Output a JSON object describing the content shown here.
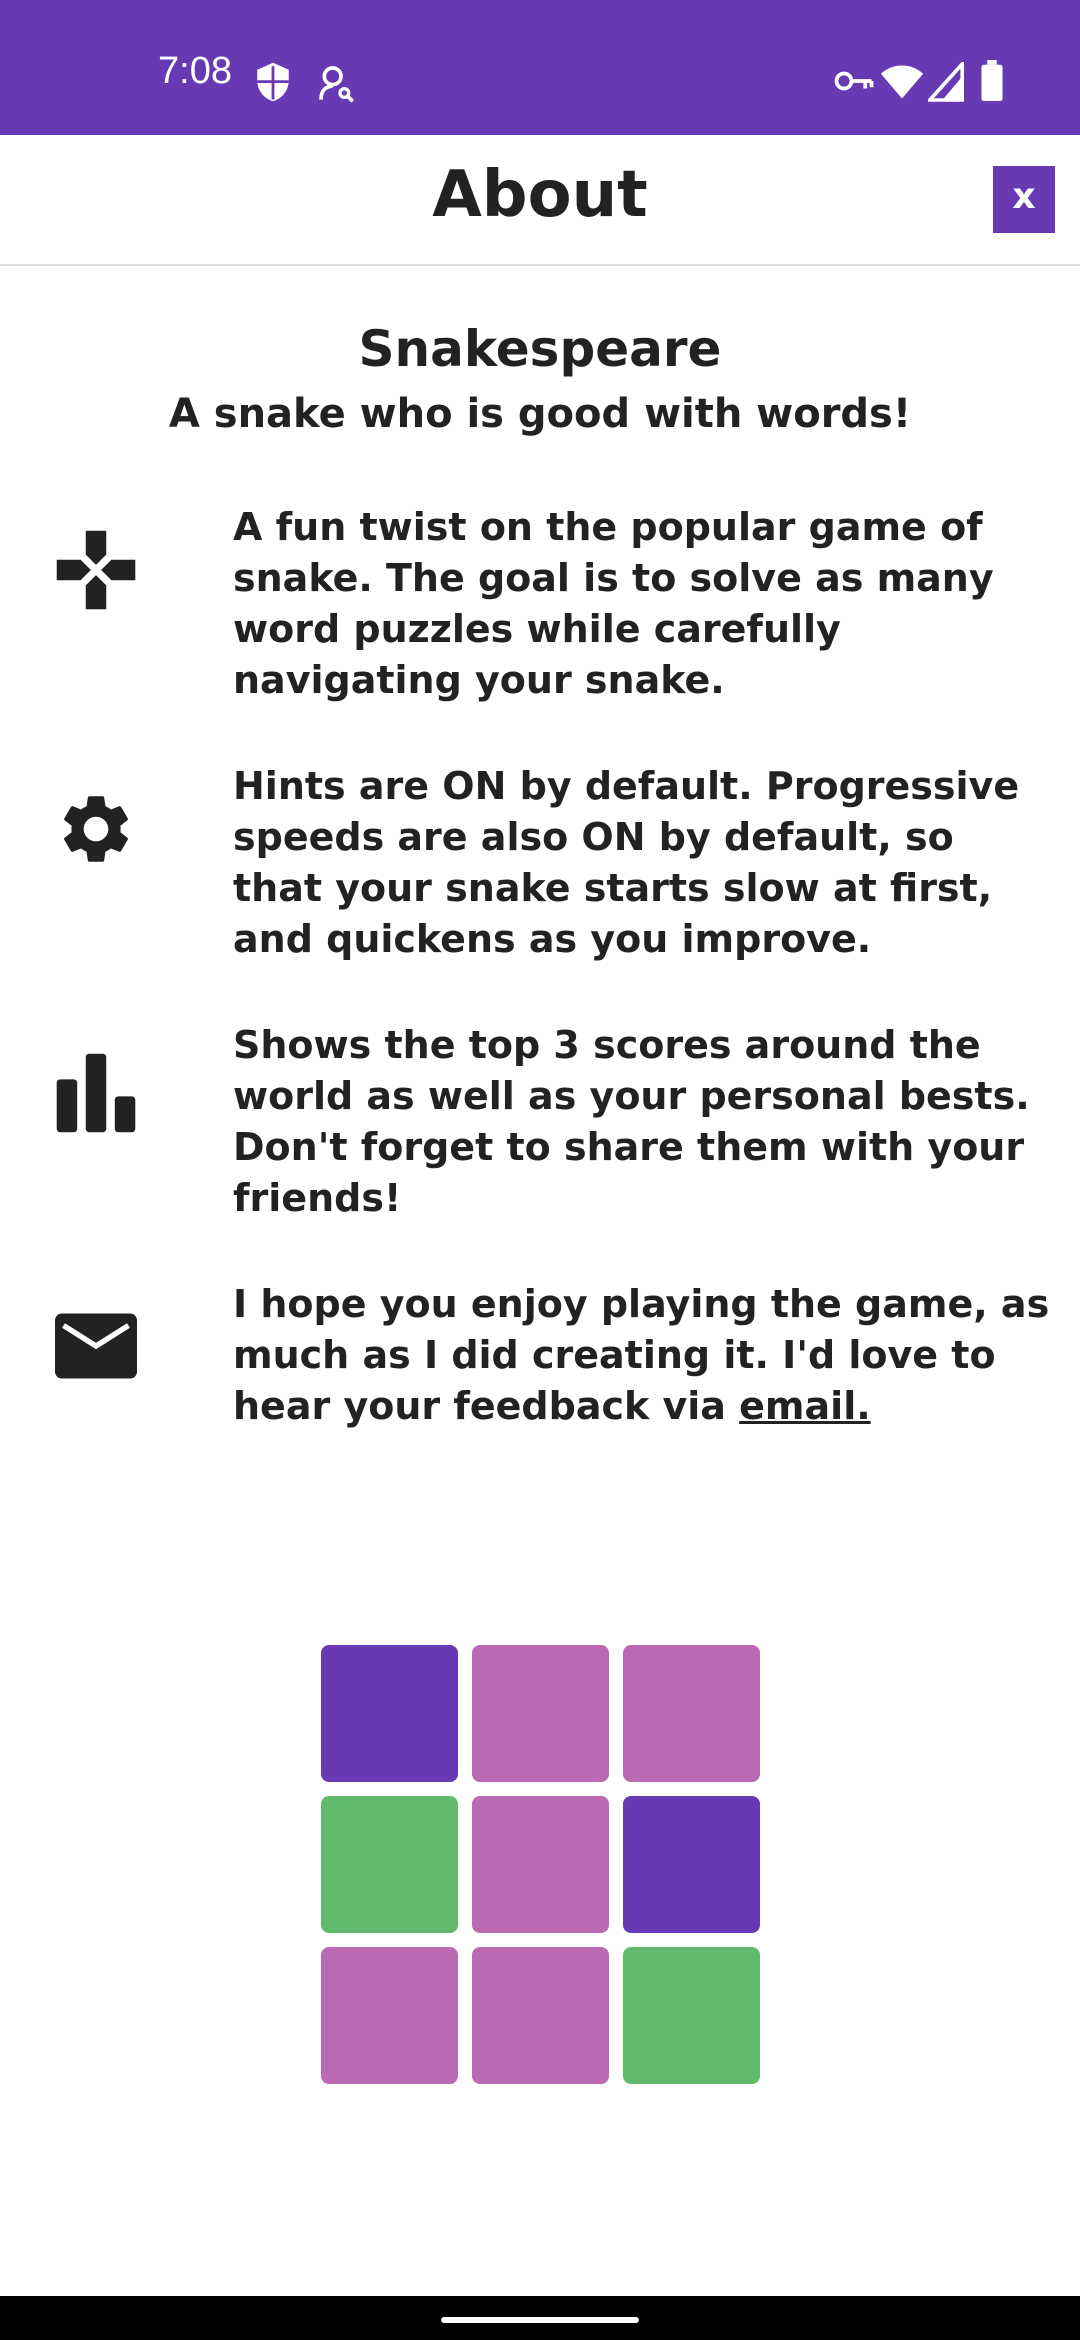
{
  "status_bar": {
    "time": "7:08",
    "background": "#673AB4",
    "left_icons": [
      "shield-icon",
      "account-key-icon"
    ],
    "right_icons": [
      "vpn-key-icon",
      "wifi-icon",
      "signal-icon",
      "battery-icon"
    ]
  },
  "header": {
    "title": "About",
    "close_label": "x"
  },
  "about": {
    "app_name": "Snakespeare",
    "tagline": "A snake who is good with words!",
    "features": [
      {
        "icon": "gamepad-icon",
        "text": "A fun twist on the popular game of snake. The goal is to solve as many word puzzles while carefully navigating your snake."
      },
      {
        "icon": "gear-icon",
        "text": "Hints are ON by default. Progressive speeds are also ON by default, so that your snake starts slow at first, and quickens as you improve."
      },
      {
        "icon": "bar-chart-icon",
        "text": "Shows the top 3 scores around the world as well as your personal bests. Don't forget to share them with your friends!"
      },
      {
        "icon": "mail-icon",
        "text_before_link": "I hope you enjoy playing the game, as much as I did creating it. I'd love to hear your feedback via ",
        "link_text": "email."
      }
    ]
  },
  "tile_grid": {
    "colors": {
      "purple": "#673AB4",
      "pink": "#BC69B4",
      "green": "#61B96E"
    },
    "rows": [
      [
        "purple",
        "pink",
        "pink"
      ],
      [
        "green",
        "pink",
        "purple"
      ],
      [
        "pink",
        "pink",
        "green"
      ]
    ]
  }
}
